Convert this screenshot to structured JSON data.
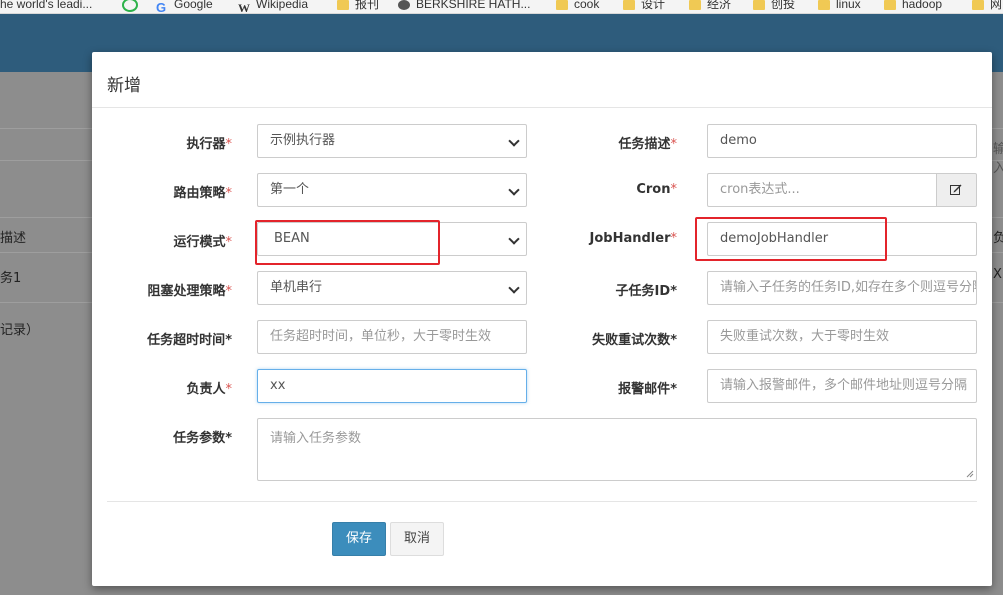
{
  "bookmarks": [
    {
      "label": "he world's leadi...",
      "icon": "site-icon"
    },
    {
      "label": "",
      "icon": "loop-icon"
    },
    {
      "label": "Google",
      "icon": "google-icon"
    },
    {
      "label": "Wikipedia",
      "icon": "wikipedia-icon"
    },
    {
      "label": "报刊",
      "icon": "folder-icon"
    },
    {
      "label": "BERKSHIRE HATH...",
      "icon": "berkshire-icon"
    },
    {
      "label": "cook",
      "icon": "folder-icon"
    },
    {
      "label": "设计",
      "icon": "folder-icon"
    },
    {
      "label": "经济",
      "icon": "folder-icon"
    },
    {
      "label": "创投",
      "icon": "folder-icon"
    },
    {
      "label": "linux",
      "icon": "folder-icon"
    },
    {
      "label": "hadoop",
      "icon": "folder-icon"
    },
    {
      "label": "网",
      "icon": "folder-icon"
    }
  ],
  "background": {
    "col_header": "描述",
    "row1": "务1",
    "row2": "记录）",
    "right_header": "负",
    "right_row": "X",
    "right_input": "输入"
  },
  "modal": {
    "title": "新增",
    "required_mark": "*",
    "fields": {
      "executor": {
        "label": "执行器",
        "value": "示例执行器",
        "required": true
      },
      "job_desc": {
        "label": "任务描述",
        "value": "demo",
        "required": true
      },
      "route_strategy": {
        "label": "路由策略",
        "value": "第一个",
        "required": true
      },
      "cron": {
        "label": "Cron",
        "placeholder": "cron表达式...",
        "required": true
      },
      "glue_type": {
        "label": "运行模式",
        "value": "BEAN",
        "required": true
      },
      "job_handler": {
        "label": "JobHandler",
        "value": "demoJobHandler",
        "required": true
      },
      "block_strategy": {
        "label": "阻塞处理策略",
        "value": "单机串行",
        "required": true
      },
      "child_job_id": {
        "label": "子任务ID",
        "placeholder": "请输入子任务的任务ID,如存在多个则逗号分隔",
        "required": true
      },
      "timeout": {
        "label": "任务超时时间",
        "placeholder": "任务超时时间，单位秒，大于零时生效",
        "required": true
      },
      "fail_retry": {
        "label": "失败重试次数",
        "placeholder": "失败重试次数，大于零时生效",
        "required": true
      },
      "author": {
        "label": "负责人",
        "value": "xx",
        "required": true
      },
      "alarm_email": {
        "label": "报警邮件",
        "placeholder": "请输入报警邮件，多个邮件地址则逗号分隔",
        "required": true
      },
      "executor_param": {
        "label": "任务参数",
        "placeholder": "请输入任务参数",
        "required": true
      }
    },
    "buttons": {
      "save": "保存",
      "cancel": "取消"
    }
  },
  "colors": {
    "header": "#2e5c7c",
    "primary": "#3c8dbc",
    "required": "#d9534f",
    "highlight": "#e3242b"
  }
}
